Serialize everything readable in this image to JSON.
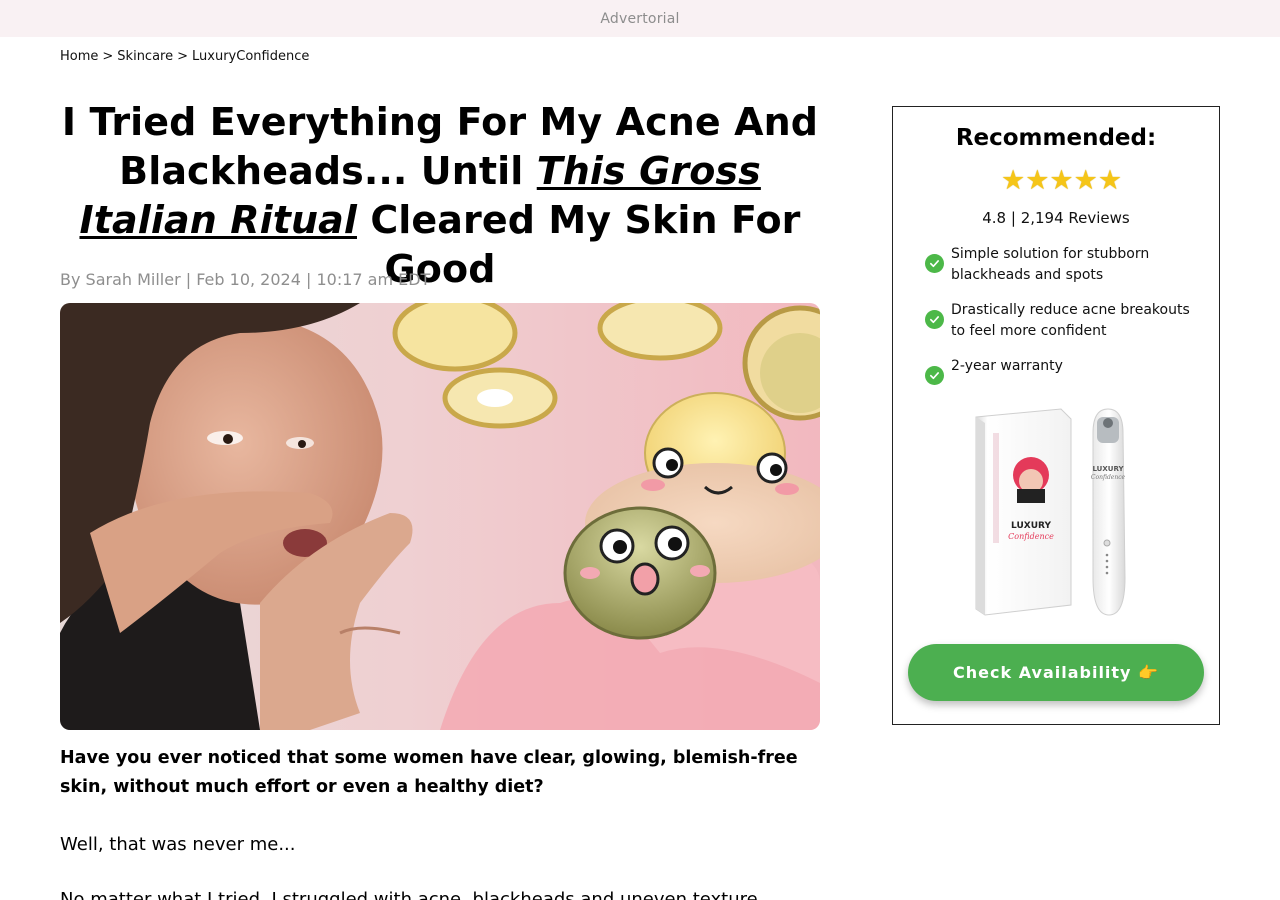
{
  "ad_bar": {
    "label": "Advertorial"
  },
  "breadcrumb": {
    "items": [
      "Home",
      "Skincare",
      "LuxuryConfidence"
    ],
    "separator": ">"
  },
  "article": {
    "headline_part1": "I Tried Everything For My Acne And Blackheads... Until ",
    "headline_emphasis": "This Gross Italian Ritual",
    "headline_part2": " Cleared My Skin For Good",
    "byline": "By Sarah Miller | Feb 10, 2024 | 10:17 am EDT",
    "lede": "Have you ever noticed that some women have clear, glowing, blemish-free skin, without much effort or even a healthy diet?",
    "paragraphs": [
      "Well, that was never me...",
      "No matter what I tried, I struggled with acne, blackheads and uneven texture."
    ]
  },
  "sidebar": {
    "title": "Recommended:",
    "stars": "★★★★★",
    "rating_text": "4.8 | 2,194 Reviews",
    "benefits": [
      "Simple solution for stubborn blackheads and spots",
      "Drastically reduce acne breakouts to feel more confident",
      "2-year warranty"
    ],
    "product_brand": "LUXURY",
    "product_subbrand": "Confidence",
    "cta_label": "Check Availability 👉"
  },
  "colors": {
    "ad_bar_bg": "#f9f1f3",
    "cta_green": "#4caf50",
    "check_green": "#4cb848",
    "star_gold": "#f5c518"
  }
}
